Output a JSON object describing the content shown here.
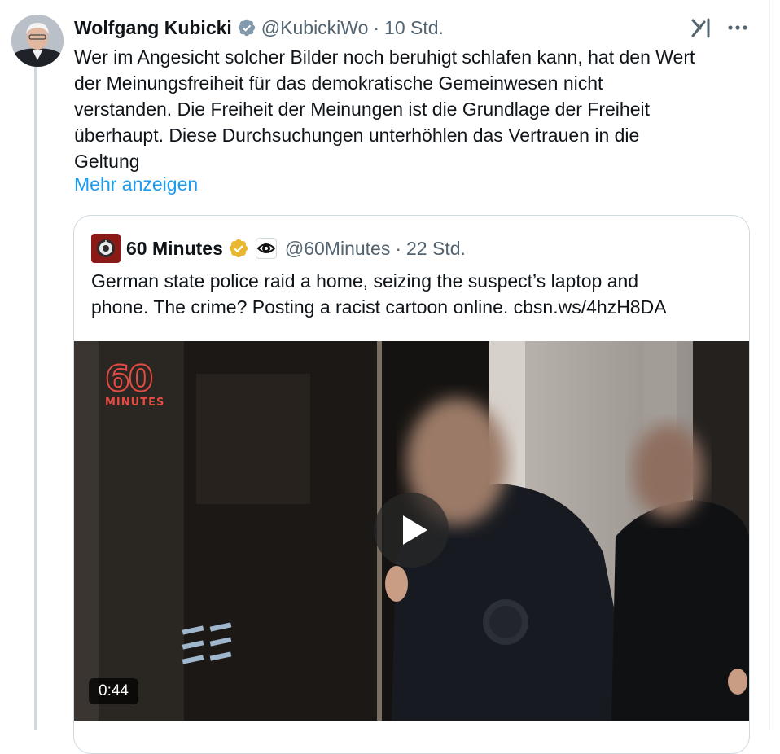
{
  "tweet": {
    "author_name": "Wolfgang Kubicki",
    "author_handle": "@KubickiWo",
    "separator": "·",
    "time": "10 Std.",
    "body_lines": [
      "Wer im Angesicht solcher Bilder noch beruhigt schlafen kann, hat den Wert",
      "der Meinungsfreiheit für das demokratische Gemeinwesen nicht",
      "verstanden. Die Freiheit der Meinungen ist die Grundlage der Freiheit",
      "überhaupt. Diese Durchsuchungen unterhöhlen das Vertrauen in die",
      "Geltung"
    ],
    "show_more": "Mehr anzeigen",
    "icons": [
      "avatar",
      "verified-badge-icon",
      "grok-icon",
      "more-icon"
    ]
  },
  "quote": {
    "author_name": "60 Minutes",
    "author_handle": "@60Minutes",
    "separator": "·",
    "time": "22 Std.",
    "body_lines": [
      "German state police raid a home, seizing the suspect’s laptop and",
      "phone. The crime? Posting a racist cartoon online. cbsn.ws/4hzH8DA"
    ],
    "icons": [
      "gold-verified-badge-icon",
      "cbs-eye-icon"
    ],
    "video": {
      "watermark_number": "60",
      "watermark_word": "MINUTES",
      "duration": "0:44",
      "icon": "play-icon"
    }
  },
  "colors": {
    "text": "#0f1419",
    "secondary": "#536471",
    "link": "#1d9bf0",
    "border": "#cfd9de",
    "watermark": "#e34b44",
    "gold_badge": "#e8b730"
  }
}
